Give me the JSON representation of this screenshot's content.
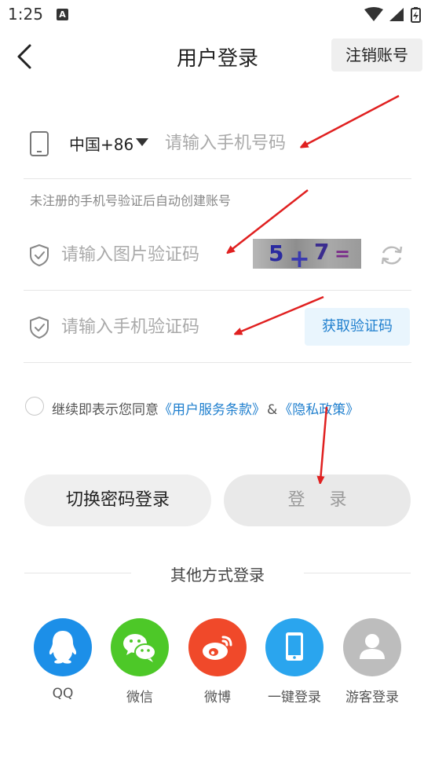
{
  "status_bar": {
    "time": "1:25",
    "a_badge": "A"
  },
  "header": {
    "title": "用户登录",
    "cancel_account_label": "注销账号"
  },
  "phone": {
    "country_code": "中国+86",
    "placeholder": "请输入手机号码"
  },
  "hint": "未注册的手机号验证后自动创建账号",
  "image_captcha": {
    "placeholder": "请输入图片验证码",
    "chars": [
      "5",
      "+",
      "7",
      "="
    ]
  },
  "sms_code": {
    "placeholder": "请输入手机验证码",
    "get_code_label": "获取验证码"
  },
  "agreement": {
    "prefix": "继续即表示您同意",
    "terms_link": "《用户服务条款》",
    "separator": "&",
    "privacy_link": "《隐私政策》",
    "checked": false
  },
  "buttons": {
    "switch_label": "切换密码登录",
    "login_label": "登 录"
  },
  "other_login": {
    "title": "其他方式登录",
    "methods": [
      {
        "label": "QQ",
        "icon": "qq-icon",
        "color": "#1c8fe8"
      },
      {
        "label": "微信",
        "icon": "wechat-icon",
        "color": "#4dc828"
      },
      {
        "label": "微博",
        "icon": "weibo-icon",
        "color": "#f0492a"
      },
      {
        "label": "一键登录",
        "icon": "phone-icon",
        "color": "#2aa5ee"
      },
      {
        "label": "游客登录",
        "icon": "guest-icon",
        "color": "#bdbdbd"
      }
    ]
  },
  "colors": {
    "link": "#1f7fce",
    "annotation": "#e02020"
  }
}
